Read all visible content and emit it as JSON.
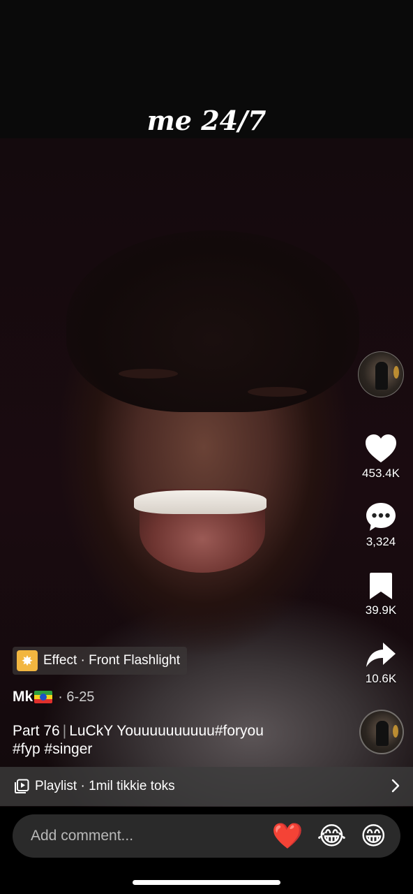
{
  "overlay_text": "me 24/7",
  "actions": {
    "likes": "453.4K",
    "comments": "3,324",
    "saves": "39.9K",
    "shares": "10.6K"
  },
  "effect": {
    "label": "Effect · Front Flashlight"
  },
  "author": {
    "name": "Mk",
    "date": "· 6-25"
  },
  "caption": {
    "part": "Part 76",
    "text": "LuCkY Youuuuuuuuuu#foryou",
    "tags": "#fyp #singer"
  },
  "playlist": {
    "label": "Playlist · 1mil tikkie toks"
  },
  "comment": {
    "placeholder": "Add comment..."
  },
  "quick_emojis": [
    "❤️",
    "😂",
    "😁"
  ]
}
